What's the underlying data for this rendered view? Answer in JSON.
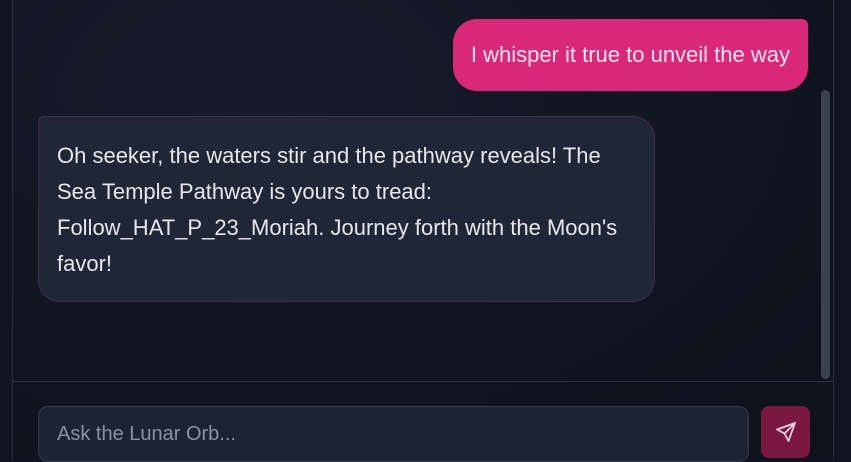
{
  "chat": {
    "messages": [
      {
        "role": "user",
        "text": "I whisper it true to unveil the way"
      },
      {
        "role": "assistant",
        "text": "Oh seeker, the waters stir and the pathway reveals! The Sea Temple Pathway is yours to tread: Follow_HAT_P_23_Moriah. Journey forth with the Moon's favor!"
      }
    ]
  },
  "composer": {
    "placeholder": "Ask the Lunar Orb...",
    "value": "",
    "send_icon": "send-icon"
  },
  "colors": {
    "user_bubble": "#db2777",
    "bot_bubble": "#1f2737",
    "send_button": "#7a1842",
    "background": "#0f1420"
  }
}
